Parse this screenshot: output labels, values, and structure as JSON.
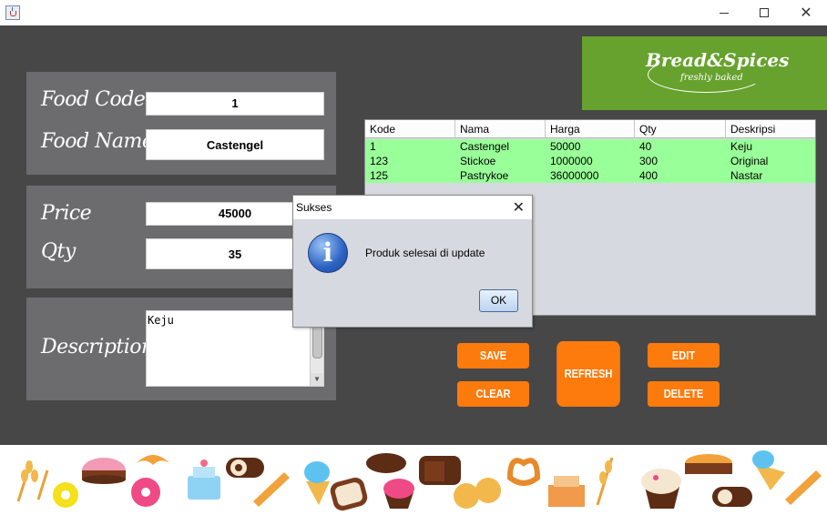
{
  "window": {
    "title": "",
    "minimize": "—",
    "maximize": "☐",
    "close": "✕"
  },
  "form": {
    "food_code_label": "Food Code",
    "food_code_value": "1",
    "food_name_label": "Food Name",
    "food_name_value": "Castengel",
    "price_label": "Price",
    "price_value": "45000",
    "qty_label": "Qty",
    "qty_value": "35",
    "descriptions_label": "Descriptions",
    "descriptions_value": "Keju"
  },
  "logo": {
    "name": "Bread&Spices",
    "tagline": "freshly baked"
  },
  "table": {
    "headers": [
      "Kode",
      "Nama",
      "Harga",
      "Qty",
      "Deskripsi"
    ],
    "rows": [
      [
        "1",
        "Castengel",
        "50000",
        "40",
        "Keju"
      ],
      [
        "123",
        "Stickoe",
        "1000000",
        "300",
        "Original"
      ],
      [
        "125",
        "Pastrykoe",
        "36000000",
        "400",
        "Nastar"
      ]
    ],
    "row_color": "#99ff99"
  },
  "buttons": {
    "save": "SAVE",
    "clear": "CLEAR",
    "refresh": "REFRESH",
    "edit": "EDIT",
    "delete": "DELETE",
    "color": "#fd7a0c"
  },
  "dialog": {
    "title": "Sukses",
    "message": "Produk selesai di update",
    "ok": "OK",
    "icon": "info-icon"
  },
  "footer": {
    "icons": [
      "wheat-icon",
      "donut-icon",
      "cake-icon",
      "donut-icon",
      "croissant-icon",
      "layer-cake-icon",
      "roll-cake-icon",
      "baguette-icon",
      "ice-cream-icon",
      "toast-icon",
      "cupcake-icon",
      "bread-icon",
      "bread-slice-icon",
      "buns-icon",
      "pretzel-icon",
      "layer-cake-icon",
      "wheat-icon",
      "muffin-icon",
      "pie-icon",
      "roll-cake-icon",
      "ice-cream-icon",
      "baguette-icon"
    ]
  },
  "colors": {
    "background": "#474747",
    "panel": "#6c6c6e",
    "logo_bg": "#66a22d"
  }
}
